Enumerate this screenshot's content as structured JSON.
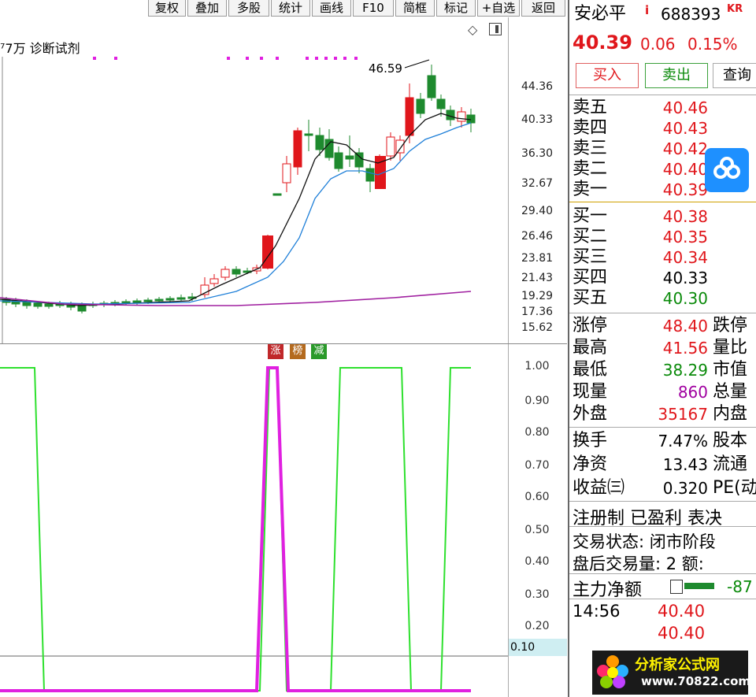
{
  "toolbar": {
    "buttons": [
      "复权",
      "叠加",
      "多股",
      "统计",
      "画线",
      "F10",
      "简框",
      "标记",
      "+自选",
      "返回"
    ]
  },
  "chart": {
    "header_text": "⁷7万 诊断试剂",
    "peak_label": "46.59",
    "y_labels_top": [
      "44.36",
      "40.33",
      "36.30",
      "32.67",
      "29.40",
      "26.46",
      "23.81",
      "21.43",
      "19.29",
      "17.36",
      "15.62"
    ],
    "y_labels_bottom": [
      "1.00",
      "0.90",
      "0.80",
      "0.70",
      "0.60",
      "0.50",
      "0.40",
      "0.30",
      "0.20",
      "0.10"
    ],
    "current_indicator_value": "0.10",
    "tags": [
      {
        "text": "涨",
        "color": "#c0282a"
      },
      {
        "text": "榜",
        "color": "#b46a1e"
      },
      {
        "text": "减",
        "color": "#2a9a2a"
      }
    ],
    "colors": {
      "up": "#e0161b",
      "down": "#1e8a2e",
      "ma_short": "#111111",
      "ma_mid": "#1e7fd8",
      "ma_long": "#a020a0",
      "ind_green": "#2ee02e",
      "ind_magenta": "#e020e0"
    }
  },
  "panel": {
    "stock_name": "安必平",
    "stock_flag": "i",
    "stock_code": "688393",
    "stock_suffix": "KR",
    "price": "40.39",
    "change": "0.06",
    "change_pct": "0.15%",
    "buy_label": "买入",
    "sell_label": "卖出",
    "query_label": "查询",
    "asks": [
      {
        "label": "卖五",
        "price": "40.46",
        "color": "red"
      },
      {
        "label": "卖四",
        "price": "40.43",
        "color": "red"
      },
      {
        "label": "卖三",
        "price": "40.42",
        "color": "red"
      },
      {
        "label": "卖二",
        "price": "40.40",
        "color": "red"
      },
      {
        "label": "卖一",
        "price": "40.39",
        "color": "red"
      }
    ],
    "bids": [
      {
        "label": "买一",
        "price": "40.38",
        "color": "red"
      },
      {
        "label": "买二",
        "price": "40.35",
        "color": "red"
      },
      {
        "label": "买三",
        "price": "40.34",
        "color": "red"
      },
      {
        "label": "买四",
        "price": "40.33",
        "color": "black"
      },
      {
        "label": "买五",
        "price": "40.30",
        "color": "green"
      }
    ],
    "stats": [
      {
        "label": "涨停",
        "value": "48.40",
        "color": "red",
        "label2": "跌停"
      },
      {
        "label": "最高",
        "value": "41.56",
        "color": "red",
        "label2": "量比"
      },
      {
        "label": "最低",
        "value": "38.29",
        "color": "green",
        "label2": "市值"
      },
      {
        "label": "现量",
        "value": "860",
        "color": "purple",
        "label2": "总量"
      },
      {
        "label": "外盘",
        "value": "35167",
        "color": "red",
        "label2": "内盘"
      }
    ],
    "stats2": [
      {
        "label": "换手",
        "value": "7.47%",
        "label2": "股本"
      },
      {
        "label": "净资",
        "value": "13.43",
        "label2": "流通"
      },
      {
        "label": "收益㈢",
        "value": "0.320",
        "label2": "PE(动"
      }
    ],
    "reg_text": "注册制 已盈利 表决",
    "trade_status": "交易状态: 闭市阶段",
    "after_hours": "盘后交易量: 2  额:",
    "main_flow_label": "主力净额",
    "main_flow_value": "-87",
    "ticks": [
      {
        "time": "14:56",
        "price": "40.40"
      },
      {
        "time": "",
        "price": "40.40"
      }
    ]
  },
  "logo": {
    "text": "分析家公式网",
    "url": "www.70822.com"
  },
  "watermark": "分析家公式网www.70822.com"
}
